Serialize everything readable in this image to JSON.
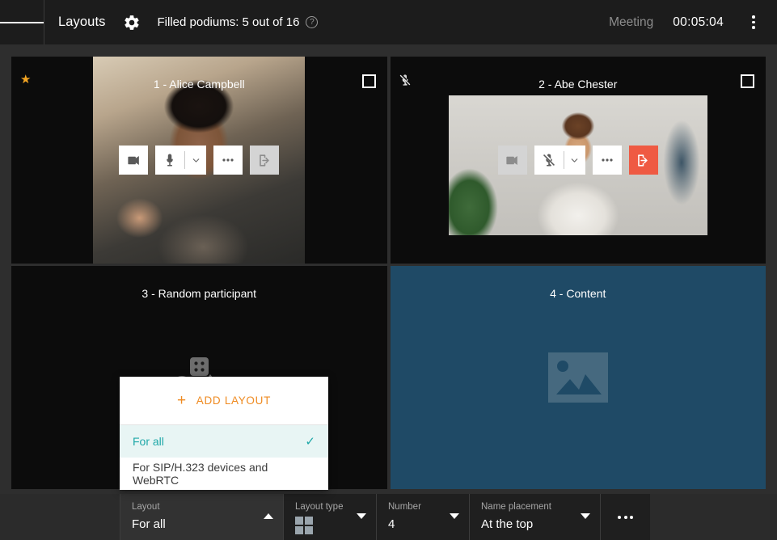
{
  "header": {
    "menu_icon": "hamburger-icon",
    "title": "Layouts",
    "settings_icon": "gear-icon",
    "podiums_text": "Filled podiums: 5 out of 16",
    "help_icon": "help-circle-icon",
    "help_glyph": "?",
    "meeting_label": "Meeting",
    "meeting_timer": "00:05:04",
    "overflow_icon": "kebab-menu-icon"
  },
  "tiles": [
    {
      "name": "1 - Alice Campbell",
      "pinned_icon": "star-icon",
      "pinned_glyph": "★",
      "checkbox_checked": false,
      "controls": {
        "camera": {
          "icon": "video-camera-icon",
          "state": "enabled"
        },
        "microphone": {
          "icon": "microphone-icon",
          "state": "enabled",
          "caret_icon": "chevron-down-icon"
        },
        "more": {
          "icon": "ellipsis-icon"
        },
        "disconnect": {
          "icon": "exit-arrow-icon",
          "state": "disabled"
        }
      }
    },
    {
      "name": "2 - Abe Chester",
      "muted_icon": "microphone-muted-icon",
      "checkbox_checked": false,
      "controls": {
        "camera": {
          "icon": "video-camera-icon",
          "state": "disabled"
        },
        "microphone": {
          "icon": "microphone-muted-icon",
          "state": "muted",
          "caret_icon": "chevron-down-icon"
        },
        "more": {
          "icon": "ellipsis-icon"
        },
        "disconnect": {
          "icon": "exit-arrow-icon",
          "state": "danger"
        }
      }
    },
    {
      "name": "3 - Random participant",
      "placeholder_icon": "random-shapes-icon"
    },
    {
      "name": "4 - Content",
      "placeholder_icon": "image-placeholder-icon"
    }
  ],
  "layout_menu": {
    "add_label": "ADD LAYOUT",
    "add_icon": "plus-icon",
    "items": [
      {
        "label": "For all",
        "selected": true,
        "check_icon": "check-icon",
        "check_glyph": "✓"
      },
      {
        "label": "For SIP/H.323 devices and WebRTC",
        "selected": false
      }
    ]
  },
  "toolbar": {
    "layout": {
      "label": "Layout",
      "value": "For all",
      "arrow": "caret-up-icon"
    },
    "layout_type": {
      "label": "Layout type",
      "value_icon": "grid-2x2-icon",
      "arrow": "caret-down-icon"
    },
    "number": {
      "label": "Number",
      "value": "4",
      "arrow": "caret-down-icon"
    },
    "name_placement": {
      "label": "Name placement",
      "value": "At the top",
      "arrow": "caret-down-icon"
    },
    "more": {
      "icon": "ellipsis-icon"
    }
  },
  "colors": {
    "accent_orange": "#ef8b22",
    "accent_teal": "#1fa8a8",
    "danger_red": "#ef5a43",
    "star_gold": "#f5a623",
    "content_tile_bg": "#1f4a66",
    "header_bg": "#1c1c1c",
    "app_bg": "#2e2e2e"
  }
}
